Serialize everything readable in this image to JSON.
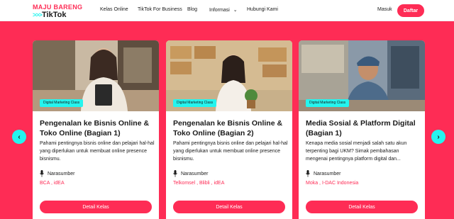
{
  "logo": {
    "line1a": "MAJU",
    "line1b": "BARENG",
    "line2": "TikTok",
    "chevrons": ">>>"
  },
  "nav": {
    "items": [
      "Kelas Online",
      "TikTok For Business",
      "Blog",
      "Informasi",
      "Hubungi Kami"
    ],
    "dropdown_icon": "chevron-down-icon"
  },
  "auth": {
    "login": "Masuk",
    "register": "Daftar"
  },
  "colors": {
    "primary": "#fe2c55",
    "accent": "#25f4ee"
  },
  "carousel": {
    "prev_icon": "chevron-left-icon",
    "next_icon": "chevron-right-icon",
    "cards": [
      {
        "badge": "Digital Marketing Class",
        "title": "Pengenalan ke Bisnis Online & Toko Online (Bagian 1)",
        "desc": "Pahami pentingnya bisnis online dan pelajari hal-hal yang diperlukan untuk membuat online presence bisnismu.",
        "speaker_label": "Narasumber",
        "sponsors": "BCA ,  idEA",
        "button": "Detail Kelas"
      },
      {
        "badge": "Digital Marketing Class",
        "title": "Pengenalan ke Bisnis Online & Toko Online (Bagian 2)",
        "desc": "Pahami pentingnya bisnis online dan pelajari hal-hal yang diperlukan untuk membuat online presence bisnismu.",
        "speaker_label": "Narasumber",
        "sponsors": "Telkomsel ,  Blibli ,  idEA",
        "button": "Detail Kelas"
      },
      {
        "badge": "Digital Marketing Class",
        "title": "Media Sosial & Platform Digital (Bagian 1)",
        "desc": "Kenapa media sosial menjadi salah satu akun terpenting bagi UKM? Simak pembahasan mengenai pentingnya platform digital dan...",
        "speaker_label": "Narasumber",
        "sponsors": "Moka ,  I-DAC Indonesia",
        "button": "Detail Kelas"
      }
    ]
  }
}
